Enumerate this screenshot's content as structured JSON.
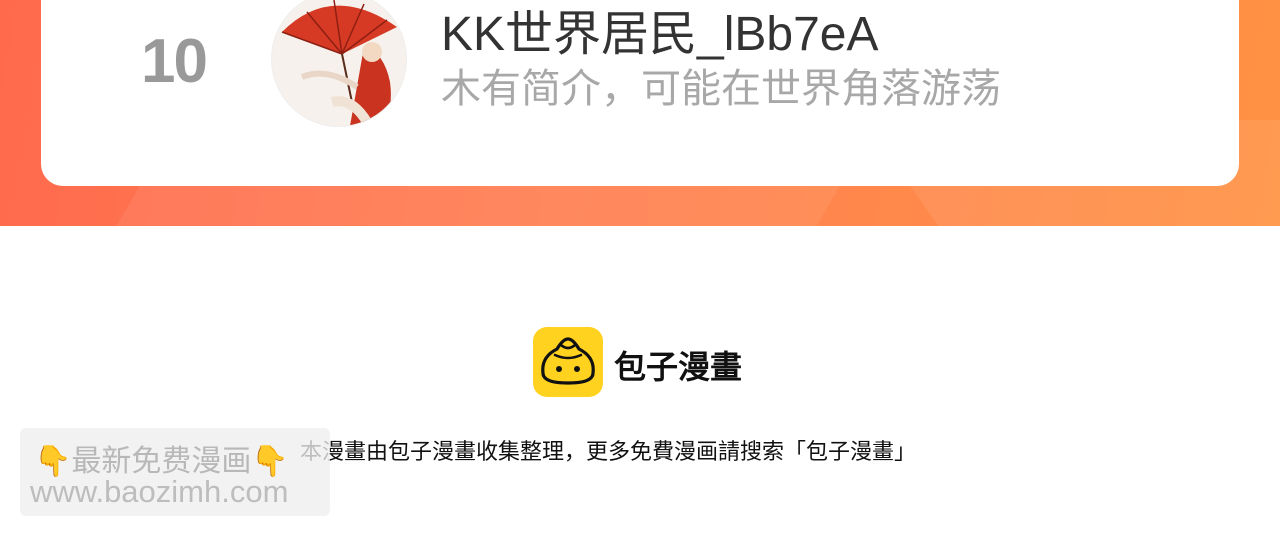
{
  "ranking": {
    "rank": "10",
    "user_name": "KK世界居民_lBb7eA",
    "bio": "木有简介，可能在世界角落游荡"
  },
  "footer": {
    "brand_name": "包子漫畫",
    "note": "本漫畫由包子漫畫收集整理，更多免費漫画請搜索「包子漫畫」"
  },
  "watermark": {
    "line1": "最新免费漫画",
    "line2": "www.baozimh.com",
    "icon": "pointing-down-hand-icon"
  },
  "colors": {
    "band_start": "#ff6a4d",
    "band_end": "#ff9243",
    "logo_yellow": "#ffd21f",
    "rank_gray": "#999999",
    "bio_gray": "#a8a8a8"
  }
}
